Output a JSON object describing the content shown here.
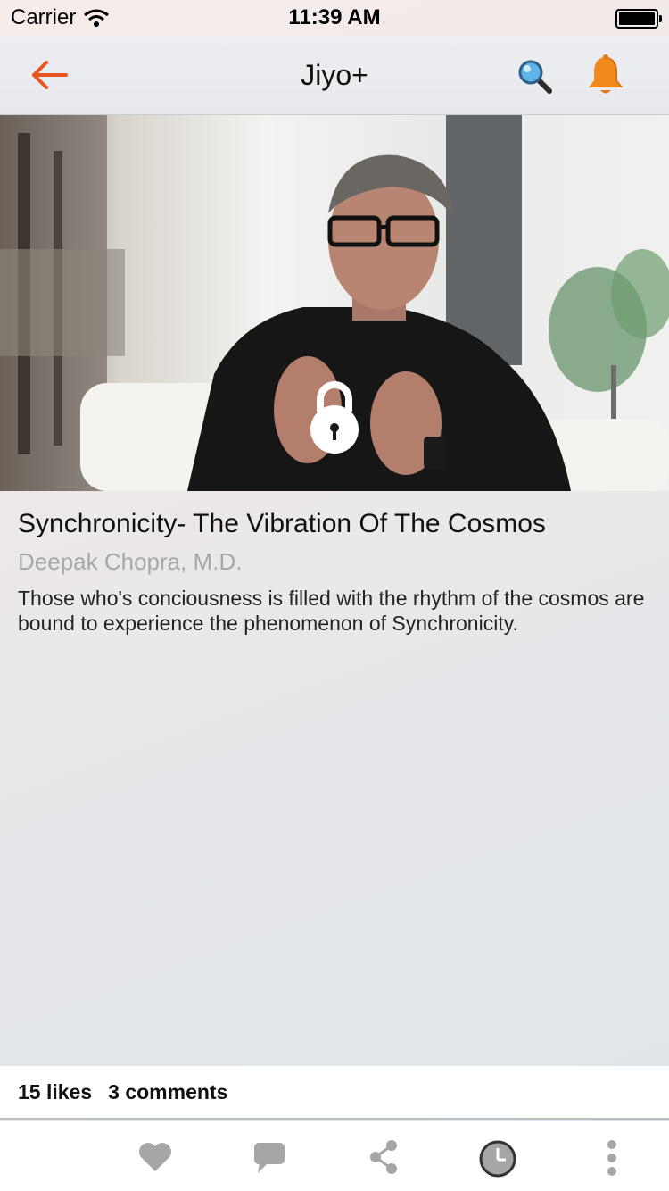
{
  "status_bar": {
    "carrier": "Carrier",
    "time": "11:39 AM"
  },
  "nav": {
    "title": "Jiyo+"
  },
  "hero": {
    "locked": true
  },
  "content": {
    "title": "Synchronicity- The Vibration Of The Cosmos",
    "author": "Deepak Chopra, M.D.",
    "description": "Those who's conciousness is filled with the rhythm of the cosmos are bound to experience the phenomenon of Synchronicity."
  },
  "stats": {
    "likes": "15 likes",
    "comments": "3 comments"
  },
  "colors": {
    "accent": "#e8541f",
    "bell": "#f18a1d",
    "icon_gray": "#a6a6a6"
  },
  "toolbar_icons": [
    "heart-icon",
    "comment-icon",
    "share-icon",
    "clock-icon",
    "more-icon"
  ]
}
